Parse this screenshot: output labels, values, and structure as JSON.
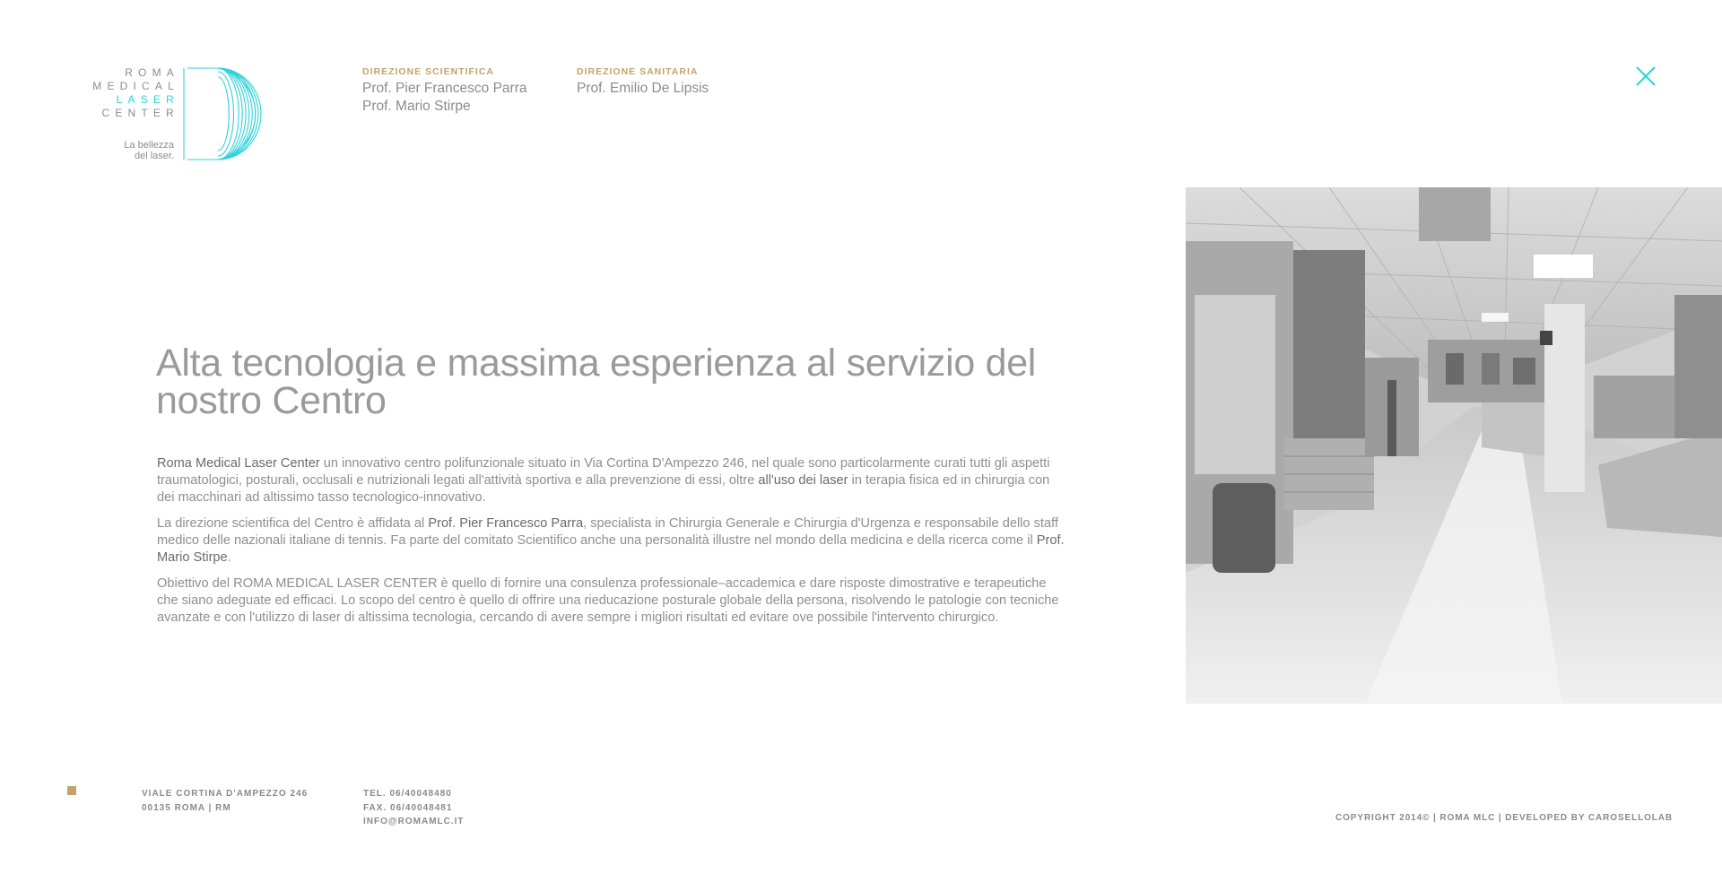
{
  "logo": {
    "words": [
      "ROMA",
      "MEDICAL",
      "LASER",
      "CENTER"
    ],
    "tagline_1": "La bellezza",
    "tagline_2": "del laser.",
    "accent_color": "#2fd2da"
  },
  "header": {
    "direzione_scientifica": {
      "label": "DIREZIONE SCIENTIFICA",
      "names": [
        "Prof. Pier Francesco Parra",
        "Prof. Mario Stirpe"
      ]
    },
    "direzione_sanitaria": {
      "label": "DIREZIONE SANITARIA",
      "names": [
        "Prof. Emilio De Lipsis"
      ]
    },
    "close_icon": "close-x-icon"
  },
  "main": {
    "headline": "Alta tecnologia e massima esperienza al servizio del nostro Centro",
    "p1": {
      "lead": "Roma Medical Laser Center",
      "text_a": " un innovativo centro polifunzionale situato in Via Cortina D'Ampezzo 246, nel quale sono particolarmente curati tutti gli aspetti traumatologici, posturali, occlusali e nutrizionali legati all'attività sportiva e alla prevenzione di essi, oltre ",
      "emph": "all'uso dei laser",
      "text_b": " in terapia fisica ed in chirurgia con dei macchinari ad altissimo tasso tecnologico-innovativo."
    },
    "p2": {
      "text_a": "La direzione scientifica del Centro è affidata al ",
      "emph_a": "Prof. Pier Francesco Parra",
      "text_b": ", specialista in Chirurgia Generale e Chirurgia d'Urgenza e responsabile dello staff medico delle nazionali italiane di tennis. Fa parte del comitato Scientifico anche una personalità illustre nel mondo della medicina e della ricerca come il ",
      "emph_b": "Prof. Mario Stirpe",
      "text_c": "."
    },
    "p3": "Obiettivo del ROMA MEDICAL LASER CENTER è quello di fornire una consulenza professionale–accademica e dare risposte dimostrative e terapeutiche che siano adeguate ed efficaci. Lo scopo del centro è quello di offrire una rieducazione posturale globale della persona, risolvendo le patologie con tecniche avanzate e con l'utilizzo di laser di altissima tecnologia, cercando di avere sempre i migliori risultati ed evitare ove possibile l'intervento chirurgico."
  },
  "footer": {
    "address_1": "VIALE CORTINA D'AMPEZZO 246",
    "address_2": "00135 ROMA | RM",
    "tel": "TEL. 06/40048480",
    "fax": "FAX. 06/40048481",
    "email": "INFO@ROMAMLC.IT",
    "copyright": "COPYRIGHT 2014© | ROMA MLC | DEVELOPED BY CAROSELLOLAB",
    "gold_color": "#c4a26c"
  }
}
